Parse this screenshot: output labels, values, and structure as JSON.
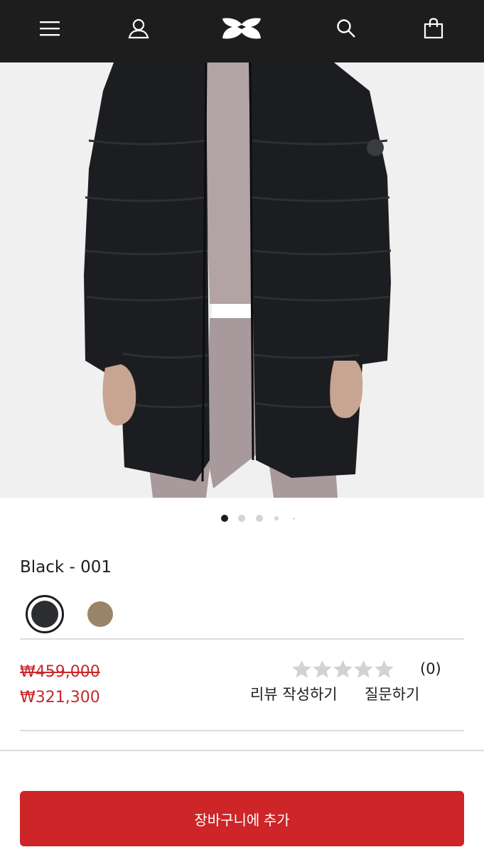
{
  "header": {
    "icons": [
      "menu-icon",
      "account-icon",
      "brand-logo",
      "search-icon",
      "cart-icon"
    ],
    "colors": {
      "background": "#1d1d1d",
      "icon": "#ffffff"
    }
  },
  "gallery": {
    "image_alt": "black long puffer jacket",
    "slide_count": 5,
    "active_slide": 1
  },
  "product": {
    "color_label": "Black - 001",
    "swatches": [
      {
        "name": "black",
        "color": "#2b2d31",
        "selected": true
      },
      {
        "name": "tan",
        "color": "#9a8467",
        "selected": false
      }
    ],
    "price_original": "₩459,000",
    "price_sale": "₩321,300",
    "price_color": "#c9262a",
    "rating": {
      "stars_filled": 0,
      "stars_total": 5,
      "count": "(0)"
    },
    "write_review_label": "리뷰 작성하기",
    "question_label": "질문하기"
  },
  "actions": {
    "add_to_cart_label": "장바구니에 추가",
    "button_color": "#cd2528"
  }
}
